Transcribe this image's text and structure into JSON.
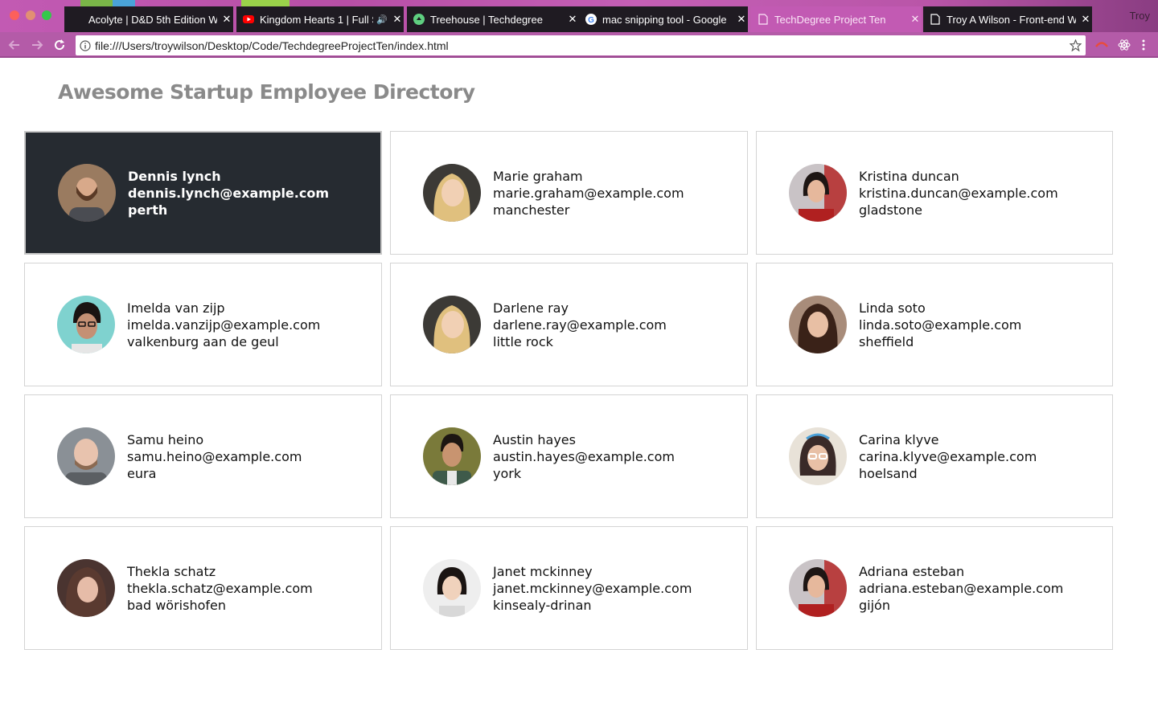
{
  "browser": {
    "tabs": [
      {
        "title": "Acolyte | D&D 5th Edition W",
        "icon": "document-icon"
      },
      {
        "title": "Kingdom Hearts 1 | Full S",
        "icon": "youtube-icon"
      },
      {
        "title": "Treehouse | Techdegree",
        "icon": "treehouse-icon"
      },
      {
        "title": "mac snipping tool - Google",
        "icon": "google-icon"
      },
      {
        "title": "TechDegree Project Ten",
        "icon": "document-icon"
      },
      {
        "title": "Troy A Wilson - Front-end W",
        "icon": "document-icon"
      }
    ],
    "profile_name": "Troy",
    "url": "file:///Users/troywilson/Desktop/Code/TechdegreeProjectTen/index.html"
  },
  "page": {
    "title": "Awesome Startup Employee Directory"
  },
  "employees": [
    {
      "name": "Dennis lynch",
      "email": "dennis.lynch@example.com",
      "city": "perth"
    },
    {
      "name": "Marie graham",
      "email": "marie.graham@example.com",
      "city": "manchester"
    },
    {
      "name": "Kristina duncan",
      "email": "kristina.duncan@example.com",
      "city": "gladstone"
    },
    {
      "name": "Imelda van zijp",
      "email": "imelda.vanzijp@example.com",
      "city": "valkenburg aan de geul"
    },
    {
      "name": "Darlene ray",
      "email": "darlene.ray@example.com",
      "city": "little rock"
    },
    {
      "name": "Linda soto",
      "email": "linda.soto@example.com",
      "city": "sheffield"
    },
    {
      "name": "Samu heino",
      "email": "samu.heino@example.com",
      "city": "eura"
    },
    {
      "name": "Austin hayes",
      "email": "austin.hayes@example.com",
      "city": "york"
    },
    {
      "name": "Carina klyve",
      "email": "carina.klyve@example.com",
      "city": "hoelsand"
    },
    {
      "name": "Thekla schatz",
      "email": "thekla.schatz@example.com",
      "city": "bad wörishofen"
    },
    {
      "name": "Janet mckinney",
      "email": "janet.mckinney@example.com",
      "city": "kinsealy-drinan"
    },
    {
      "name": "Adriana esteban",
      "email": "adriana.esteban@example.com",
      "city": "gijón"
    }
  ],
  "colors": {
    "chrome_tab_strip": "#c25ab3",
    "chrome_toolbar": "#b45ba8",
    "selected_card_bg": "#262b31",
    "page_title": "#8a8a8a"
  }
}
